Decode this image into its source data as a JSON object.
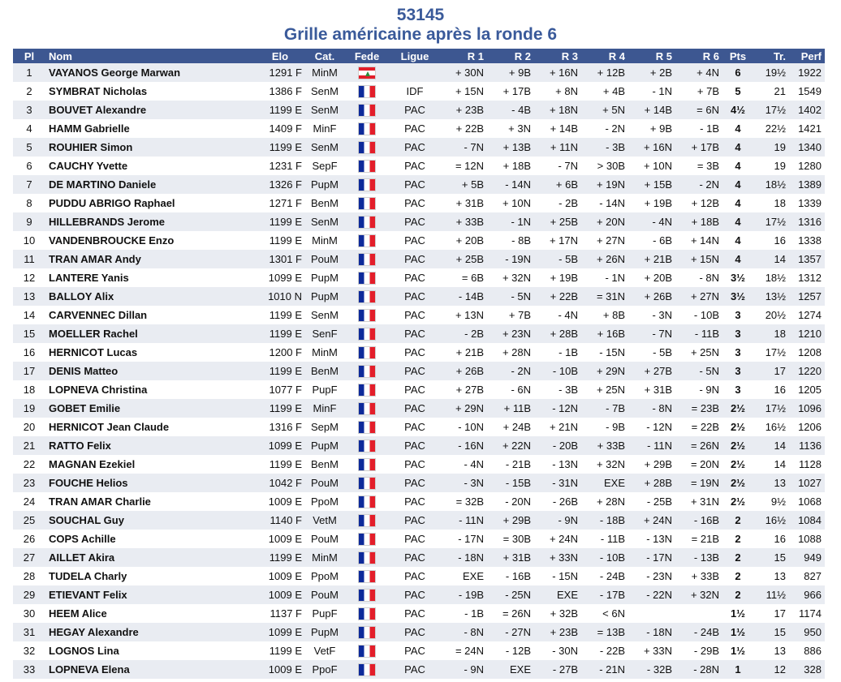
{
  "header": {
    "tournament_id": "53145",
    "subtitle": "Grille américaine après la ronde 6"
  },
  "columns": [
    "Pl",
    "Nom",
    "Elo",
    "Cat.",
    "Fede",
    "Ligue",
    "R 1",
    "R 2",
    "R 3",
    "R 4",
    "R 5",
    "R 6",
    "Pts",
    "Tr.",
    "Perf"
  ],
  "flags": {
    "FRA": "flag-fr",
    "LBN": "flag-lb"
  },
  "rows": [
    {
      "pl": "1",
      "nom": "VAYANOS George Marwan",
      "elo": "1291 F",
      "cat": "MinM",
      "fede": "LBN",
      "ligue": "",
      "r": [
        "+ 30N",
        "+ 9B",
        "+ 16N",
        "+ 12B",
        "+ 2B",
        "+ 4N"
      ],
      "pts": "6",
      "tr": "19½",
      "perf": "1922"
    },
    {
      "pl": "2",
      "nom": "SYMBRAT Nicholas",
      "elo": "1386 F",
      "cat": "SenM",
      "fede": "FRA",
      "ligue": "IDF",
      "r": [
        "+ 15N",
        "+ 17B",
        "+ 8N",
        "+ 4B",
        "- 1N",
        "+ 7B"
      ],
      "pts": "5",
      "tr": "21",
      "perf": "1549"
    },
    {
      "pl": "3",
      "nom": "BOUVET Alexandre",
      "elo": "1199 E",
      "cat": "SenM",
      "fede": "FRA",
      "ligue": "PAC",
      "r": [
        "+ 23B",
        "- 4B",
        "+ 18N",
        "+ 5N",
        "+ 14B",
        "= 6N"
      ],
      "pts": "4½",
      "tr": "17½",
      "perf": "1402"
    },
    {
      "pl": "4",
      "nom": "HAMM Gabrielle",
      "elo": "1409 F",
      "cat": "MinF",
      "fede": "FRA",
      "ligue": "PAC",
      "r": [
        "+ 22B",
        "+ 3N",
        "+ 14B",
        "- 2N",
        "+ 9B",
        "- 1B"
      ],
      "pts": "4",
      "tr": "22½",
      "perf": "1421"
    },
    {
      "pl": "5",
      "nom": "ROUHIER Simon",
      "elo": "1199 E",
      "cat": "SenM",
      "fede": "FRA",
      "ligue": "PAC",
      "r": [
        "- 7N",
        "+ 13B",
        "+ 11N",
        "- 3B",
        "+ 16N",
        "+ 17B"
      ],
      "pts": "4",
      "tr": "19",
      "perf": "1340"
    },
    {
      "pl": "6",
      "nom": "CAUCHY Yvette",
      "elo": "1231 F",
      "cat": "SepF",
      "fede": "FRA",
      "ligue": "PAC",
      "r": [
        "= 12N",
        "+ 18B",
        "- 7N",
        "> 30B",
        "+ 10N",
        "= 3B"
      ],
      "pts": "4",
      "tr": "19",
      "perf": "1280"
    },
    {
      "pl": "7",
      "nom": "DE MARTINO Daniele",
      "elo": "1326 F",
      "cat": "PupM",
      "fede": "FRA",
      "ligue": "PAC",
      "r": [
        "+ 5B",
        "- 14N",
        "+ 6B",
        "+ 19N",
        "+ 15B",
        "- 2N"
      ],
      "pts": "4",
      "tr": "18½",
      "perf": "1389"
    },
    {
      "pl": "8",
      "nom": "PUDDU ABRIGO Raphael",
      "elo": "1271 F",
      "cat": "BenM",
      "fede": "FRA",
      "ligue": "PAC",
      "r": [
        "+ 31B",
        "+ 10N",
        "- 2B",
        "- 14N",
        "+ 19B",
        "+ 12B"
      ],
      "pts": "4",
      "tr": "18",
      "perf": "1339"
    },
    {
      "pl": "9",
      "nom": "HILLEBRANDS Jerome",
      "elo": "1199 E",
      "cat": "SenM",
      "fede": "FRA",
      "ligue": "PAC",
      "r": [
        "+ 33B",
        "- 1N",
        "+ 25B",
        "+ 20N",
        "- 4N",
        "+ 18B"
      ],
      "pts": "4",
      "tr": "17½",
      "perf": "1316"
    },
    {
      "pl": "10",
      "nom": "VANDENBROUCKE Enzo",
      "elo": "1199 E",
      "cat": "MinM",
      "fede": "FRA",
      "ligue": "PAC",
      "r": [
        "+ 20B",
        "- 8B",
        "+ 17N",
        "+ 27N",
        "- 6B",
        "+ 14N"
      ],
      "pts": "4",
      "tr": "16",
      "perf": "1338"
    },
    {
      "pl": "11",
      "nom": "TRAN AMAR Andy",
      "elo": "1301 F",
      "cat": "PouM",
      "fede": "FRA",
      "ligue": "PAC",
      "r": [
        "+ 25B",
        "- 19N",
        "- 5B",
        "+ 26N",
        "+ 21B",
        "+ 15N"
      ],
      "pts": "4",
      "tr": "14",
      "perf": "1357"
    },
    {
      "pl": "12",
      "nom": "LANTERE Yanis",
      "elo": "1099 E",
      "cat": "PupM",
      "fede": "FRA",
      "ligue": "PAC",
      "r": [
        "= 6B",
        "+ 32N",
        "+ 19B",
        "- 1N",
        "+ 20B",
        "- 8N"
      ],
      "pts": "3½",
      "tr": "18½",
      "perf": "1312"
    },
    {
      "pl": "13",
      "nom": "BALLOY Alix",
      "elo": "1010 N",
      "cat": "PupM",
      "fede": "FRA",
      "ligue": "PAC",
      "r": [
        "- 14B",
        "- 5N",
        "+ 22B",
        "= 31N",
        "+ 26B",
        "+ 27N"
      ],
      "pts": "3½",
      "tr": "13½",
      "perf": "1257"
    },
    {
      "pl": "14",
      "nom": "CARVENNEC Dillan",
      "elo": "1199 E",
      "cat": "SenM",
      "fede": "FRA",
      "ligue": "PAC",
      "r": [
        "+ 13N",
        "+ 7B",
        "- 4N",
        "+ 8B",
        "- 3N",
        "- 10B"
      ],
      "pts": "3",
      "tr": "20½",
      "perf": "1274"
    },
    {
      "pl": "15",
      "nom": "MOELLER Rachel",
      "elo": "1199 E",
      "cat": "SenF",
      "fede": "FRA",
      "ligue": "PAC",
      "r": [
        "- 2B",
        "+ 23N",
        "+ 28B",
        "+ 16B",
        "- 7N",
        "- 11B"
      ],
      "pts": "3",
      "tr": "18",
      "perf": "1210"
    },
    {
      "pl": "16",
      "nom": "HERNICOT Lucas",
      "elo": "1200 F",
      "cat": "MinM",
      "fede": "FRA",
      "ligue": "PAC",
      "r": [
        "+ 21B",
        "+ 28N",
        "- 1B",
        "- 15N",
        "- 5B",
        "+ 25N"
      ],
      "pts": "3",
      "tr": "17½",
      "perf": "1208"
    },
    {
      "pl": "17",
      "nom": "DENIS Matteo",
      "elo": "1199 E",
      "cat": "BenM",
      "fede": "FRA",
      "ligue": "PAC",
      "r": [
        "+ 26B",
        "- 2N",
        "- 10B",
        "+ 29N",
        "+ 27B",
        "- 5N"
      ],
      "pts": "3",
      "tr": "17",
      "perf": "1220"
    },
    {
      "pl": "18",
      "nom": "LOPNEVA Christina",
      "elo": "1077 F",
      "cat": "PupF",
      "fede": "FRA",
      "ligue": "PAC",
      "r": [
        "+ 27B",
        "- 6N",
        "- 3B",
        "+ 25N",
        "+ 31B",
        "- 9N"
      ],
      "pts": "3",
      "tr": "16",
      "perf": "1205"
    },
    {
      "pl": "19",
      "nom": "GOBET Emilie",
      "elo": "1199 E",
      "cat": "MinF",
      "fede": "FRA",
      "ligue": "PAC",
      "r": [
        "+ 29N",
        "+ 11B",
        "- 12N",
        "- 7B",
        "- 8N",
        "= 23B"
      ],
      "pts": "2½",
      "tr": "17½",
      "perf": "1096"
    },
    {
      "pl": "20",
      "nom": "HERNICOT Jean Claude",
      "elo": "1316 F",
      "cat": "SepM",
      "fede": "FRA",
      "ligue": "PAC",
      "r": [
        "- 10N",
        "+ 24B",
        "+ 21N",
        "- 9B",
        "- 12N",
        "= 22B"
      ],
      "pts": "2½",
      "tr": "16½",
      "perf": "1206"
    },
    {
      "pl": "21",
      "nom": "RATTO Felix",
      "elo": "1099 E",
      "cat": "PupM",
      "fede": "FRA",
      "ligue": "PAC",
      "r": [
        "- 16N",
        "+ 22N",
        "- 20B",
        "+ 33B",
        "- 11N",
        "= 26N"
      ],
      "pts": "2½",
      "tr": "14",
      "perf": "1136"
    },
    {
      "pl": "22",
      "nom": "MAGNAN Ezekiel",
      "elo": "1199 E",
      "cat": "BenM",
      "fede": "FRA",
      "ligue": "PAC",
      "r": [
        "- 4N",
        "- 21B",
        "- 13N",
        "+ 32N",
        "+ 29B",
        "= 20N"
      ],
      "pts": "2½",
      "tr": "14",
      "perf": "1128"
    },
    {
      "pl": "23",
      "nom": "FOUCHE Helios",
      "elo": "1042 F",
      "cat": "PouM",
      "fede": "FRA",
      "ligue": "PAC",
      "r": [
        "- 3N",
        "- 15B",
        "- 31N",
        "EXE",
        "+ 28B",
        "= 19N"
      ],
      "pts": "2½",
      "tr": "13",
      "perf": "1027"
    },
    {
      "pl": "24",
      "nom": "TRAN AMAR Charlie",
      "elo": "1009 E",
      "cat": "PpoM",
      "fede": "FRA",
      "ligue": "PAC",
      "r": [
        "= 32B",
        "- 20N",
        "- 26B",
        "+ 28N",
        "- 25B",
        "+ 31N"
      ],
      "pts": "2½",
      "tr": "9½",
      "perf": "1068"
    },
    {
      "pl": "25",
      "nom": "SOUCHAL Guy",
      "elo": "1140 F",
      "cat": "VetM",
      "fede": "FRA",
      "ligue": "PAC",
      "r": [
        "- 11N",
        "+ 29B",
        "- 9N",
        "- 18B",
        "+ 24N",
        "- 16B"
      ],
      "pts": "2",
      "tr": "16½",
      "perf": "1084"
    },
    {
      "pl": "26",
      "nom": "COPS Achille",
      "elo": "1009 E",
      "cat": "PouM",
      "fede": "FRA",
      "ligue": "PAC",
      "r": [
        "- 17N",
        "= 30B",
        "+ 24N",
        "- 11B",
        "- 13N",
        "= 21B"
      ],
      "pts": "2",
      "tr": "16",
      "perf": "1088"
    },
    {
      "pl": "27",
      "nom": "AILLET Akira",
      "elo": "1199 E",
      "cat": "MinM",
      "fede": "FRA",
      "ligue": "PAC",
      "r": [
        "- 18N",
        "+ 31B",
        "+ 33N",
        "- 10B",
        "- 17N",
        "- 13B"
      ],
      "pts": "2",
      "tr": "15",
      "perf": "949"
    },
    {
      "pl": "28",
      "nom": "TUDELA Charly",
      "elo": "1009 E",
      "cat": "PpoM",
      "fede": "FRA",
      "ligue": "PAC",
      "r": [
        "EXE",
        "- 16B",
        "- 15N",
        "- 24B",
        "- 23N",
        "+ 33B"
      ],
      "pts": "2",
      "tr": "13",
      "perf": "827"
    },
    {
      "pl": "29",
      "nom": "ETIEVANT Felix",
      "elo": "1009 E",
      "cat": "PouM",
      "fede": "FRA",
      "ligue": "PAC",
      "r": [
        "- 19B",
        "- 25N",
        "EXE",
        "- 17B",
        "- 22N",
        "+ 32N"
      ],
      "pts": "2",
      "tr": "11½",
      "perf": "966"
    },
    {
      "pl": "30",
      "nom": "HEEM Alice",
      "elo": "1137 F",
      "cat": "PupF",
      "fede": "FRA",
      "ligue": "PAC",
      "r": [
        "- 1B",
        "= 26N",
        "+ 32B",
        "< 6N",
        "",
        ""
      ],
      "pts": "1½",
      "tr": "17",
      "perf": "1174"
    },
    {
      "pl": "31",
      "nom": "HEGAY Alexandre",
      "elo": "1099 E",
      "cat": "PupM",
      "fede": "FRA",
      "ligue": "PAC",
      "r": [
        "- 8N",
        "- 27N",
        "+ 23B",
        "= 13B",
        "- 18N",
        "- 24B"
      ],
      "pts": "1½",
      "tr": "15",
      "perf": "950"
    },
    {
      "pl": "32",
      "nom": "LOGNOS Lina",
      "elo": "1199 E",
      "cat": "VetF",
      "fede": "FRA",
      "ligue": "PAC",
      "r": [
        "= 24N",
        "- 12B",
        "- 30N",
        "- 22B",
        "+ 33N",
        "- 29B"
      ],
      "pts": "1½",
      "tr": "13",
      "perf": "886"
    },
    {
      "pl": "33",
      "nom": "LOPNEVA Elena",
      "elo": "1009 E",
      "cat": "PpoF",
      "fede": "FRA",
      "ligue": "PAC",
      "r": [
        "- 9N",
        "EXE",
        "- 27B",
        "- 21N",
        "- 32B",
        "- 28N"
      ],
      "pts": "1",
      "tr": "12",
      "perf": "328"
    }
  ]
}
